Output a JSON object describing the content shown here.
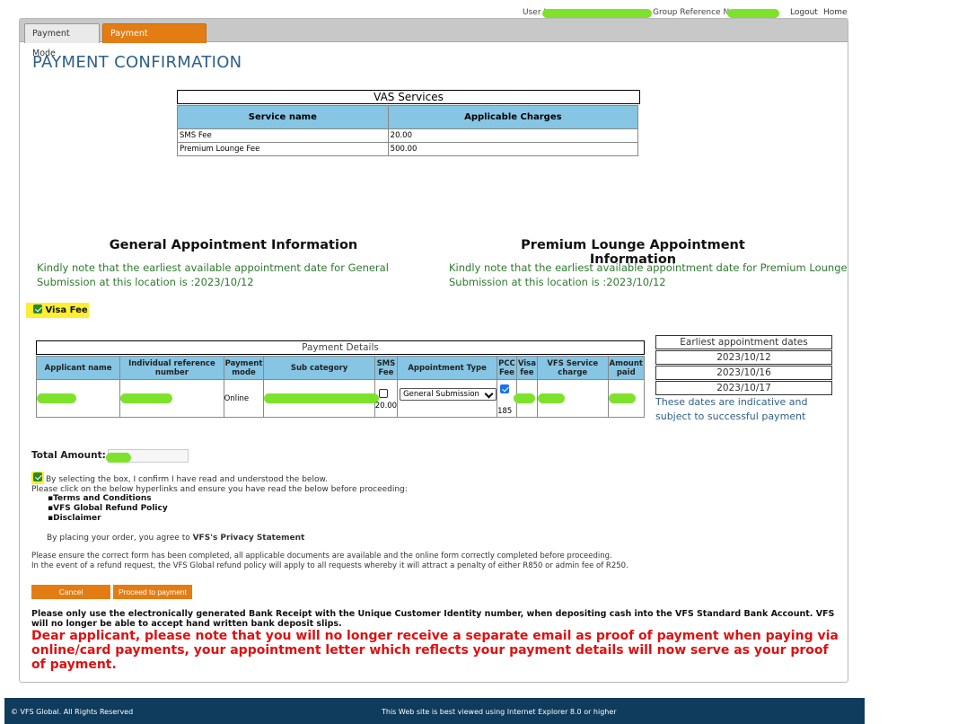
{
  "header": {
    "user_label": "User I",
    "group_ref_label": "Group Reference No",
    "logout": "Logout",
    "home": "Home"
  },
  "tabs": [
    {
      "label": "Payment Mode"
    },
    {
      "label": "Payment Confirmation"
    }
  ],
  "page_title": "PAYMENT CONFIRMATION",
  "vas": {
    "caption": "VAS Services",
    "headers": [
      "Service name",
      "Applicable Charges"
    ],
    "rows": [
      [
        "SMS Fee",
        "20.00"
      ],
      [
        "Premium Lounge Fee",
        "500.00"
      ]
    ]
  },
  "general_appt": {
    "heading": "General Appointment Information",
    "line1": "Kindly note that the earliest available appointment date for General",
    "line2": "Submission at this location is :2023/10/12"
  },
  "premium_appt": {
    "heading": "Premium Lounge Appointment Information",
    "line1": "Kindly note that the earliest available appointment date for Premium Lounge",
    "line2": "Submission at this location is :2023/10/12"
  },
  "visa_fee_label": "Visa Fee",
  "payment_details": {
    "caption": "Payment Details",
    "headers": {
      "applicant_name": "Applicant name",
      "individual_ref": "Individual reference number",
      "payment_mode": "Payment mode",
      "sub_category": "Sub category",
      "sms_fee": "SMS Fee",
      "appointment_type": "Appointment Type",
      "pcc_fee": "PCC Fee",
      "visa_fee": "Visa fee",
      "vfs_service_charge": "VFS Service charge",
      "amount_paid": "Amount paid"
    },
    "row": {
      "payment_mode": "Online",
      "sms_fee": "20.00",
      "appointment_type": "General Submission",
      "pcc_fee": "185"
    }
  },
  "earliest": {
    "heading": "Earliest appointment dates",
    "dates": [
      "2023/10/12",
      "2023/10/16",
      "2023/10/17"
    ],
    "note": "These dates are indicative and subject to successful payment"
  },
  "total_label": "Total Amount:",
  "confirm": {
    "line1": "By selecting the box, I confirm I have read and understood the below.",
    "line2": "Please click on the below hyperlinks and ensure you have read the below before proceeding:"
  },
  "links": [
    "Terms and Conditions",
    "VFS Global Refund Policy",
    "Disclaimer"
  ],
  "privacy": {
    "prefix": "By placing your order, you agree to ",
    "link": "VFS's Privacy Statement"
  },
  "notes": {
    "line1": "Please ensure the correct form has been completed, all applicable documents are available and the online form correctly completed before proceeding.",
    "line2": "In the event of a refund request, the VFS Global refund policy will apply to all requests whereby it will attract a penalty of either R850 or admin fee of R250."
  },
  "buttons": {
    "cancel": "Cancel",
    "proceed": "Proceed to payment"
  },
  "bank_notice": "Please only use the electronically generated Bank Receipt with the Unique Customer Identity number, when depositing cash into the VFS Standard Bank Account. VFS will no longer be able to accept hand written bank deposit slips.",
  "warning": "Dear applicant, please note that you will no longer receive a separate email as proof of payment when paying via online/card payments, your appointment letter which reflects your payment details will now serve as your proof of payment.",
  "footer": {
    "copyright": "© VFS Global. All Rights Reserved",
    "browser": "This Web site is best viewed using Internet Explorer 8.0 or higher"
  },
  "colors": {
    "tab_active": "#e47c14",
    "table_header": "#86c5e3",
    "title": "#2e5f8a",
    "appt_text": "#2d7a2d",
    "warning": "#dd1111",
    "footer": "#0f3b5c",
    "highlight": "#ffee32",
    "redaction": "#7ee22c"
  }
}
